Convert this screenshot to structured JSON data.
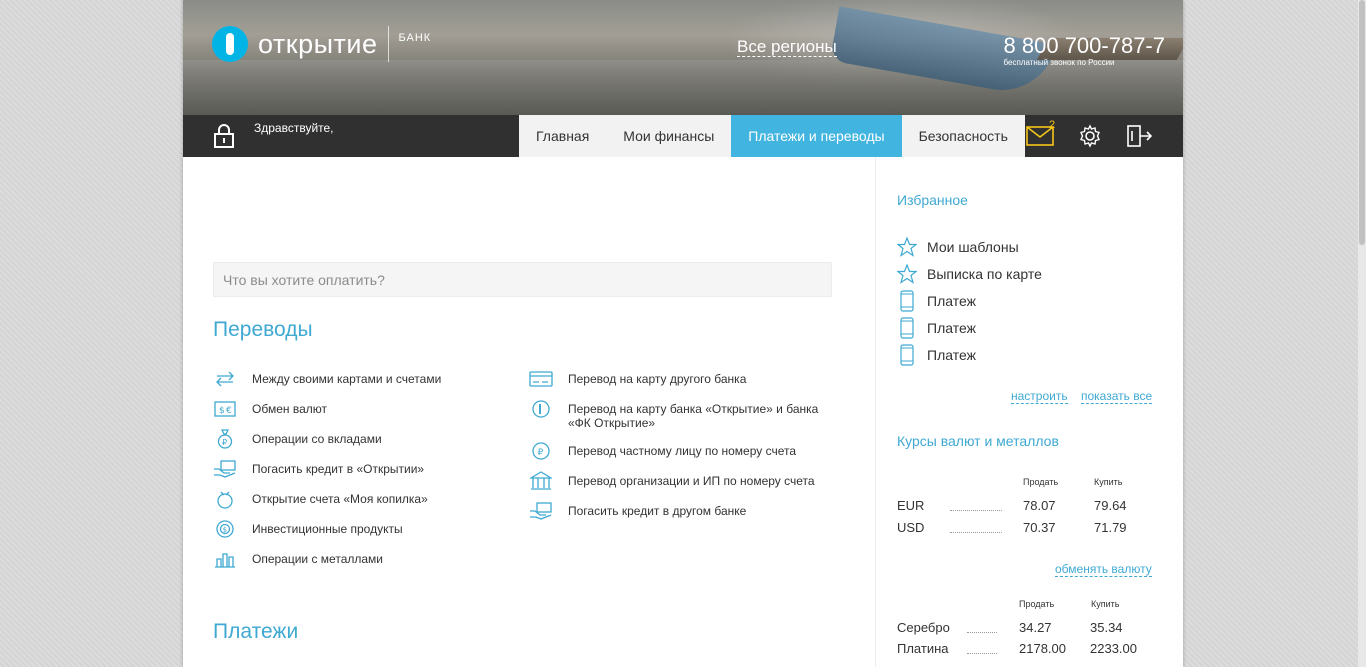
{
  "header": {
    "logo_text": "открытие",
    "logo_sub": "БАНК",
    "regions": "Все регионы",
    "phone": "8 800 700-787-7",
    "phone_note": "бесплатный звонок по России"
  },
  "navbar": {
    "greeting": "Здравствуйте,",
    "tabs": [
      {
        "label": "Главная"
      },
      {
        "label": "Мои финансы"
      },
      {
        "label": "Платежи и переводы"
      },
      {
        "label": "Безопасность"
      }
    ],
    "mail_count": "2",
    "icons": [
      "mail-icon",
      "gear-icon",
      "logout-icon"
    ],
    "colors": {
      "accent": "#42b4e0",
      "badge": "#f5c518",
      "bar": "#303030"
    }
  },
  "search": {
    "placeholder": "Что вы хотите оплатить?"
  },
  "transfers": {
    "title": "Переводы",
    "left": [
      {
        "label": "Между своими картами и счетами",
        "icon": "exchange-arrows-icon"
      },
      {
        "label": "Обмен валют",
        "icon": "currency-exchange-icon"
      },
      {
        "label": "Операции со вкладами",
        "icon": "money-bag-icon"
      },
      {
        "label": "Погасить кредит в «Открытии»",
        "icon": "loan-hand-icon"
      },
      {
        "label": "Открытие счета «Моя копилка»",
        "icon": "piggy-bank-icon"
      },
      {
        "label": "Инвестиционные продукты",
        "icon": "investment-icon"
      },
      {
        "label": "Операции с металлами",
        "icon": "metal-bars-icon"
      }
    ],
    "right": [
      {
        "label": "Перевод на карту другого банка",
        "icon": "card-icon"
      },
      {
        "label": "Перевод на карту банка «Открытие» и банка «ФК Открытие»",
        "icon": "bank-card-coin-icon"
      },
      {
        "label": "Перевод частному лицу по номеру счета",
        "icon": "ruble-coin-icon"
      },
      {
        "label": "Перевод организации и ИП по номеру счета",
        "icon": "bank-building-icon"
      },
      {
        "label": "Погасить кредит в другом банке",
        "icon": "loan-hand-icon"
      }
    ]
  },
  "payments": {
    "title": "Платежи"
  },
  "favorites": {
    "title": "Избранное",
    "items": [
      {
        "label": "Мои шаблоны",
        "icon": "star-icon"
      },
      {
        "label": "Выписка по карте",
        "icon": "star-icon"
      },
      {
        "label": "Платеж",
        "icon": "phone-icon"
      },
      {
        "label": "Платеж",
        "icon": "phone-icon"
      },
      {
        "label": "Платеж",
        "icon": "phone-icon"
      }
    ],
    "configure": "настроить",
    "show_all": "показать все"
  },
  "rates": {
    "title": "Курсы валют и металлов",
    "sell_label": "Продать",
    "buy_label": "Купить",
    "currencies": [
      {
        "name": "EUR",
        "sell": "78.07",
        "buy": "79.64"
      },
      {
        "name": "USD",
        "sell": "70.37",
        "buy": "71.79"
      }
    ],
    "exchange_link": "обменять валюту",
    "metals": [
      {
        "name": "Серебро",
        "sell": "34.27",
        "buy": "35.34"
      },
      {
        "name": "Платина",
        "sell": "2178.00",
        "buy": "2233.00"
      }
    ]
  }
}
